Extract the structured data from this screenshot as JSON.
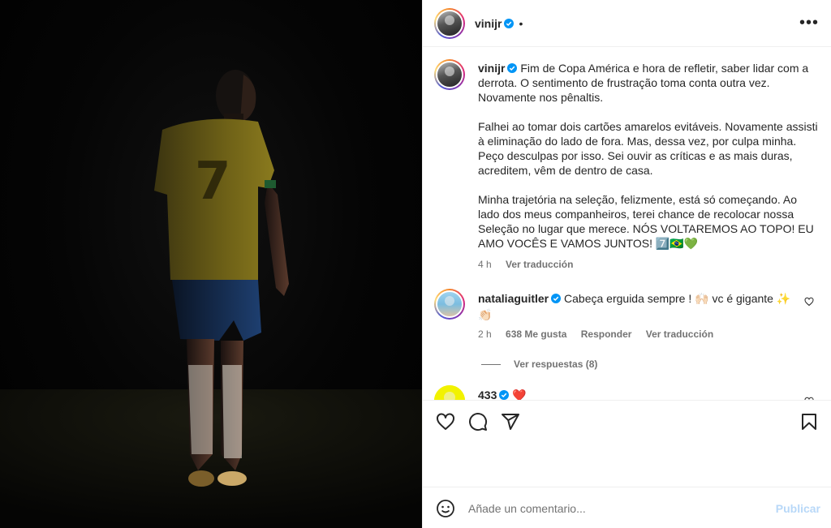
{
  "post": {
    "username": "vinijr",
    "dot": "•",
    "more": "•••"
  },
  "caption": {
    "username": "vinijr",
    "paragraphs": [
      "Fim de Copa América e hora de refletir, saber lidar com a derrota. O sentimento de frustração toma conta outra vez. Novamente nos pênaltis.",
      "Falhei ao tomar dois cartões amarelos evitáveis. Novamente assisti à eliminação do lado de fora. Mas, dessa vez, por culpa minha. Peço desculpas por isso. Sei ouvir as críticas e as mais duras, acreditem, vêm de dentro de casa.",
      "Minha trajetória na seleção, felizmente, está só começando. Ao lado dos meus companheiros, terei chance de recolocar nossa Seleção no lugar que merece. NÓS VOLTAREMOS AO TOPO! EU AMO VOCÊS E VAMOS JUNTOS! 7️⃣🇧🇷💚"
    ],
    "time": "4 h",
    "translate": "Ver traducción"
  },
  "comments": [
    {
      "username": "nataliaguitler",
      "text": "Cabeça erguida sempre ! 🙌🏻 vc é gigante ✨ 👏🏻",
      "time": "2 h",
      "likes": "638 Me gusta",
      "reply": "Responder",
      "translate": "Ver traducción",
      "view_replies": "Ver respuestas (8)"
    },
    {
      "username": "433",
      "text": "❤️"
    }
  ],
  "comment_box": {
    "placeholder": "Añade un comentario...",
    "publish": "Publicar"
  },
  "colors": {
    "verified": "#0095f6",
    "heart": "#ed4956",
    "publish_disabled": "#b8d8f8",
    "muted": "#737373"
  }
}
